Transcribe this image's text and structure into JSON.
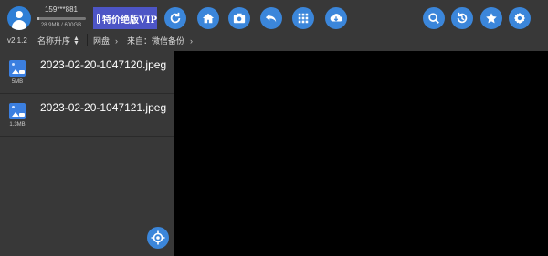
{
  "account": {
    "user": "159***881",
    "quota": "28.9MB / 600GB",
    "usage_fraction": 0.05
  },
  "vip_banner": {
    "label": "特价绝版VIP"
  },
  "toolbar": {
    "left_icons": [
      "refresh-icon",
      "home-icon",
      "camera-icon",
      "back-icon",
      "grid-icon",
      "download-icon"
    ],
    "right_icons": [
      "search-icon",
      "history-icon",
      "star-icon",
      "settings-icon"
    ]
  },
  "version": "v2.1.2",
  "sort": {
    "label": "名称升序"
  },
  "breadcrumb": {
    "root": "网盘",
    "path": "来自：微信备份"
  },
  "files": [
    {
      "name": "2023-02-20-1047120.jpeg",
      "size": "5MB",
      "icon": "image-file-icon"
    },
    {
      "name": "2023-02-20-1047121.jpeg",
      "size": "1.3MB",
      "icon": "image-file-icon"
    }
  ],
  "colors": {
    "accent": "#3b86da",
    "vip": "#4d55c6",
    "panel": "#383838",
    "viewer": "#000000"
  }
}
